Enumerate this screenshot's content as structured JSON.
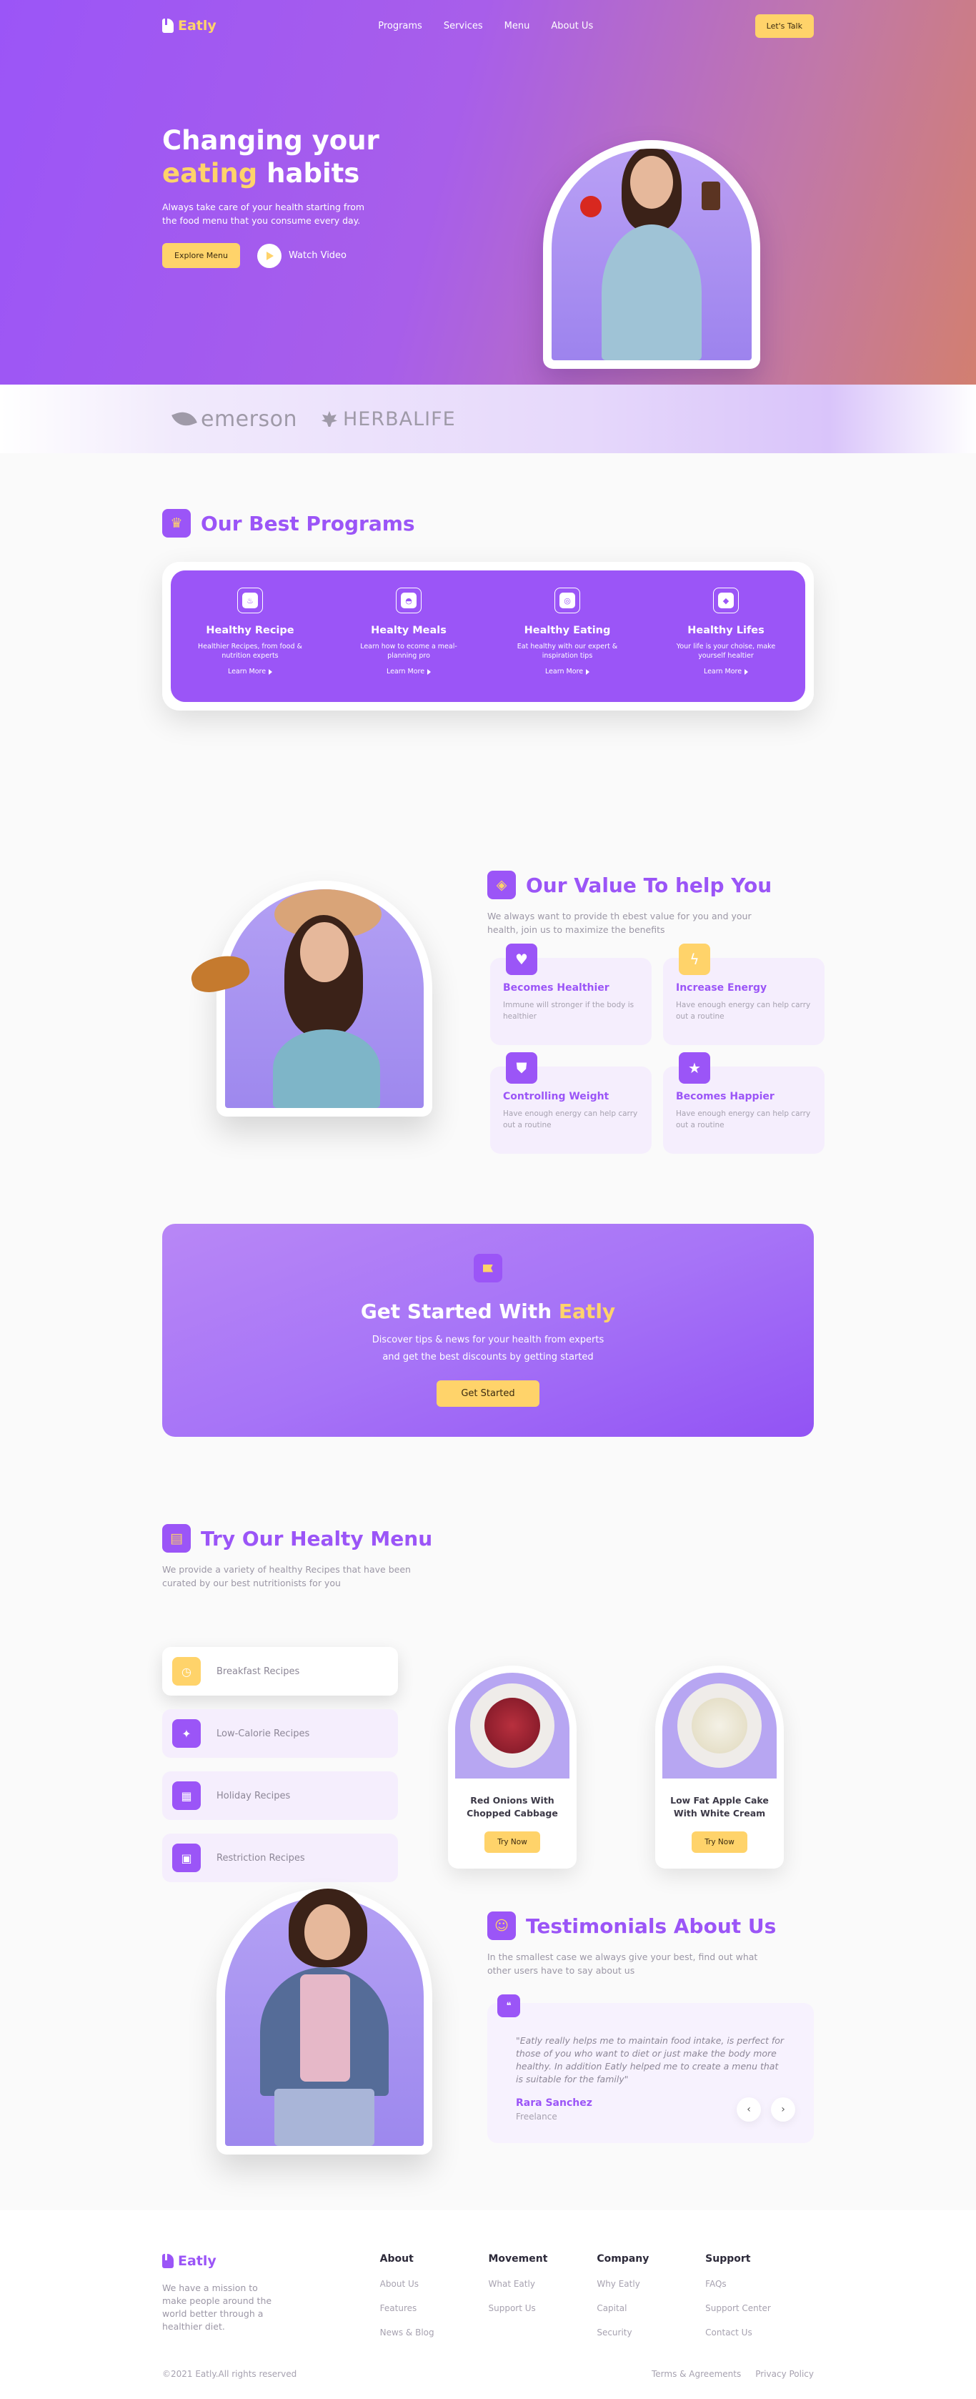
{
  "brand": {
    "name": "Eatly"
  },
  "nav": {
    "links": [
      "Programs",
      "Services",
      "Menu",
      "About Us"
    ],
    "cta": "Let's Talk"
  },
  "hero": {
    "title_line1": "Changing your",
    "title_accent": "eating",
    "title_rest": " habits",
    "description": "Always take care of your health starting from the food menu that you consume every day.",
    "explore_label": "Explore Menu",
    "watch_label": "Watch Video"
  },
  "partners": [
    "emerson",
    "HERBALIFE"
  ],
  "programs": {
    "title": "Our Best Programs",
    "items": [
      {
        "title": "Healthy Recipe",
        "desc": "Healthier Recipes, from food & nutrition experts",
        "link": "Learn More",
        "icon": "chef-hat-icon"
      },
      {
        "title": "Healty Meals",
        "desc": "Learn how to ecome a meal-planning pro",
        "link": "Learn More",
        "icon": "cloche-icon"
      },
      {
        "title": "Healthy Eating",
        "desc": "Eat healthy with our expert & inspiration tips",
        "link": "Learn More",
        "icon": "plate-icon"
      },
      {
        "title": "Healthy Lifes",
        "desc": "Your life is your choise, make yourself healtier",
        "link": "Learn More",
        "icon": "shield-icon"
      }
    ]
  },
  "values": {
    "title": "Our Value To help You",
    "description": "We always want to provide th ebest value for you and your health, join us to maximize the benefits",
    "cards": [
      {
        "title": "Becomes Healthier",
        "desc": "Immune will stronger if the body is healthier",
        "icon": "heart-icon",
        "color": "#9b55f7"
      },
      {
        "title": "Increase Energy",
        "desc": "Have enough energy can help carry out a routine",
        "icon": "lightning-icon",
        "color": "#ffd36a"
      },
      {
        "title": "Controlling Weight",
        "desc": "Have enough energy can help carry out a routine",
        "icon": "shield-icon",
        "color": "#9b55f7"
      },
      {
        "title": "Becomes Happier",
        "desc": "Have enough energy can help carry out a routine",
        "icon": "star-icon",
        "color": "#9b55f7"
      }
    ]
  },
  "cta": {
    "title": "Get Started With ",
    "title_accent": "Eatly",
    "description": "Discover tips & news for your health from experts and get the best discounts by getting started",
    "button": "Get Started"
  },
  "menu": {
    "title": "Try Our Healty Menu",
    "description": "We provide a variety of healthy Recipes that have been curated by our best nutritionists for you",
    "categories": [
      "Breakfast Recipes",
      "Low-Calorie Recipes",
      "Holiday Recipes",
      "Restriction Recipes"
    ],
    "dishes": [
      {
        "name": "Red Onions With Chopped Cabbage",
        "button": "Try Now"
      },
      {
        "name": "Low Fat Apple Cake With White Cream",
        "button": "Try Now"
      }
    ]
  },
  "testimonials": {
    "title": "Testimonials About Us",
    "description": "In the smallest case we always give your best, find out what other users have to say about us",
    "quote": "\"Eatly really helps me to maintain food intake, is perfect for those of you who want to diet or just make the body more healthy. In addition Eatly helped me to create a menu that is suitable for the family\"",
    "name": "Rara Sanchez",
    "role": "Freelance"
  },
  "footer": {
    "description": "We have a mission to make people around the world better through a healthier diet.",
    "columns": [
      {
        "title": "About",
        "links": [
          "About Us",
          "Features",
          "News & Blog"
        ]
      },
      {
        "title": "Movement",
        "links": [
          "What Eatly",
          "Support Us"
        ]
      },
      {
        "title": "Company",
        "links": [
          "Why Eatly",
          "Capital",
          "Security"
        ]
      },
      {
        "title": "Support",
        "links": [
          "FAQs",
          "Support Center",
          "Contact Us"
        ]
      }
    ],
    "copyright": "©2021 Eatly.All rights reserved",
    "legal": [
      "Terms & Agreements",
      "Privacy Policy"
    ]
  }
}
